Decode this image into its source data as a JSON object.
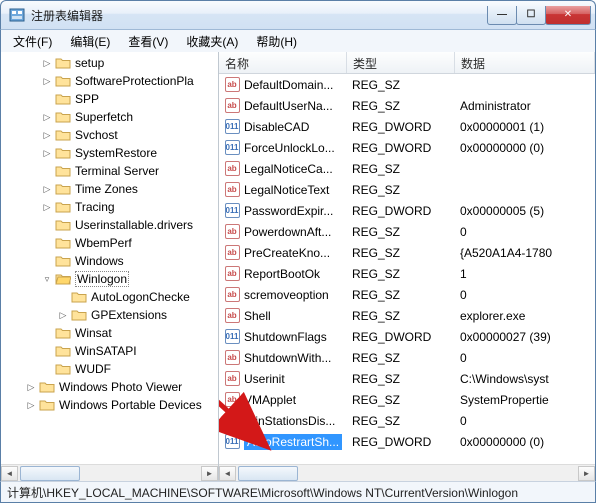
{
  "window": {
    "title": "注册表编辑器",
    "min": "—",
    "max": "☐",
    "close": "✕"
  },
  "menu": {
    "file": "文件(F)",
    "edit": "编辑(E)",
    "view": "查看(V)",
    "favorites": "收藏夹(A)",
    "help": "帮助(H)"
  },
  "columns": {
    "name": "名称",
    "type": "类型",
    "data": "数据"
  },
  "tree": [
    {
      "depth": 2,
      "toggle": "▷",
      "label": "setup"
    },
    {
      "depth": 2,
      "toggle": "▷",
      "label": "SoftwareProtectionPla"
    },
    {
      "depth": 2,
      "toggle": "",
      "label": "SPP"
    },
    {
      "depth": 2,
      "toggle": "▷",
      "label": "Superfetch"
    },
    {
      "depth": 2,
      "toggle": "▷",
      "label": "Svchost"
    },
    {
      "depth": 2,
      "toggle": "▷",
      "label": "SystemRestore"
    },
    {
      "depth": 2,
      "toggle": "",
      "label": "Terminal Server"
    },
    {
      "depth": 2,
      "toggle": "▷",
      "label": "Time Zones"
    },
    {
      "depth": 2,
      "toggle": "▷",
      "label": "Tracing"
    },
    {
      "depth": 2,
      "toggle": "",
      "label": "Userinstallable.drivers"
    },
    {
      "depth": 2,
      "toggle": "",
      "label": "WbemPerf"
    },
    {
      "depth": 2,
      "toggle": "",
      "label": "Windows"
    },
    {
      "depth": 2,
      "toggle": "▿",
      "label": "Winlogon",
      "selected": true
    },
    {
      "depth": 3,
      "toggle": "",
      "label": "AutoLogonChecke"
    },
    {
      "depth": 3,
      "toggle": "▷",
      "label": "GPExtensions"
    },
    {
      "depth": 2,
      "toggle": "",
      "label": "Winsat"
    },
    {
      "depth": 2,
      "toggle": "",
      "label": "WinSATAPI"
    },
    {
      "depth": 2,
      "toggle": "",
      "label": "WUDF"
    },
    {
      "depth": 1,
      "toggle": "▷",
      "label": "Windows Photo Viewer"
    },
    {
      "depth": 1,
      "toggle": "▷",
      "label": "Windows Portable Devices"
    }
  ],
  "values": [
    {
      "icon": "sz",
      "name": "DefaultDomain...",
      "type": "REG_SZ",
      "data": ""
    },
    {
      "icon": "sz",
      "name": "DefaultUserNa...",
      "type": "REG_SZ",
      "data": "Administrator"
    },
    {
      "icon": "dw",
      "name": "DisableCAD",
      "type": "REG_DWORD",
      "data": "0x00000001 (1)"
    },
    {
      "icon": "dw",
      "name": "ForceUnlockLo...",
      "type": "REG_DWORD",
      "data": "0x00000000 (0)"
    },
    {
      "icon": "sz",
      "name": "LegalNoticeCa...",
      "type": "REG_SZ",
      "data": ""
    },
    {
      "icon": "sz",
      "name": "LegalNoticeText",
      "type": "REG_SZ",
      "data": ""
    },
    {
      "icon": "dw",
      "name": "PasswordExpir...",
      "type": "REG_DWORD",
      "data": "0x00000005 (5)"
    },
    {
      "icon": "sz",
      "name": "PowerdownAft...",
      "type": "REG_SZ",
      "data": "0"
    },
    {
      "icon": "sz",
      "name": "PreCreateKno...",
      "type": "REG_SZ",
      "data": "{A520A1A4-1780"
    },
    {
      "icon": "sz",
      "name": "ReportBootOk",
      "type": "REG_SZ",
      "data": "1"
    },
    {
      "icon": "sz",
      "name": "scremoveoption",
      "type": "REG_SZ",
      "data": "0"
    },
    {
      "icon": "sz",
      "name": "Shell",
      "type": "REG_SZ",
      "data": "explorer.exe"
    },
    {
      "icon": "dw",
      "name": "ShutdownFlags",
      "type": "REG_DWORD",
      "data": "0x00000027 (39)"
    },
    {
      "icon": "sz",
      "name": "ShutdownWith...",
      "type": "REG_SZ",
      "data": "0"
    },
    {
      "icon": "sz",
      "name": "Userinit",
      "type": "REG_SZ",
      "data": "C:\\Windows\\syst"
    },
    {
      "icon": "sz",
      "name": "VMApplet",
      "type": "REG_SZ",
      "data": "SystemPropertie"
    },
    {
      "icon": "sz",
      "name": "WinStationsDis...",
      "type": "REG_SZ",
      "data": "0"
    },
    {
      "icon": "dw",
      "name": "AutoRestrartSh...",
      "type": "REG_DWORD",
      "data": "0x00000000 (0)",
      "selected": true
    }
  ],
  "statusbar": "计算机\\HKEY_LOCAL_MACHINE\\SOFTWARE\\Microsoft\\Windows NT\\CurrentVersion\\Winlogon",
  "icons": {
    "sz_text": "ab",
    "dw_text": "011"
  }
}
